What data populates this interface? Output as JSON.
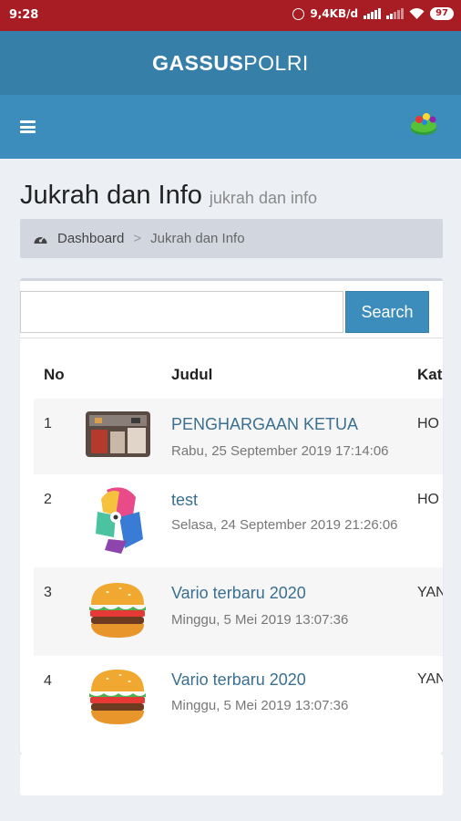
{
  "status_bar": {
    "time": "9:28",
    "net_speed": "9,4KB/d",
    "battery": "97"
  },
  "app": {
    "brand_bold": "GASSUS",
    "brand_light": "POLRI"
  },
  "page": {
    "title": "Jukrah dan Info",
    "subtitle": "jukrah dan info"
  },
  "breadcrumb": {
    "items": [
      "Dashboard",
      "Jukrah dan Info"
    ],
    "separator": ">"
  },
  "search": {
    "placeholder": "",
    "button_label": "Search"
  },
  "table": {
    "headers": [
      "No",
      "Judul",
      "Kat"
    ],
    "rows": [
      {
        "no": "1",
        "title": "PENGHARGAAN KETUA",
        "date": "Rabu, 25 September 2019 17:14:06",
        "kategori": "HO",
        "thumbnail": "photo-award-thumbnail"
      },
      {
        "no": "2",
        "title": "test",
        "date": "Selasa, 24 September 2019 21:26:06",
        "kategori": "HO",
        "thumbnail": "colorful-face-illustration"
      },
      {
        "no": "3",
        "title": "Vario terbaru 2020",
        "date": "Minggu, 5 Mei 2019 13:07:36",
        "kategori": "YAN",
        "thumbnail": "burger-illustration"
      },
      {
        "no": "4",
        "title": "Vario terbaru 2020",
        "date": "Minggu, 5 Mei 2019 13:07:36",
        "kategori": "YAN",
        "thumbnail": "burger-illustration"
      }
    ]
  },
  "colors": {
    "status_bar": "#a81d23",
    "header": "#367fa9",
    "navbar": "#3c8dbc",
    "link": "#3a6f91",
    "background": "#ecf0f5"
  }
}
